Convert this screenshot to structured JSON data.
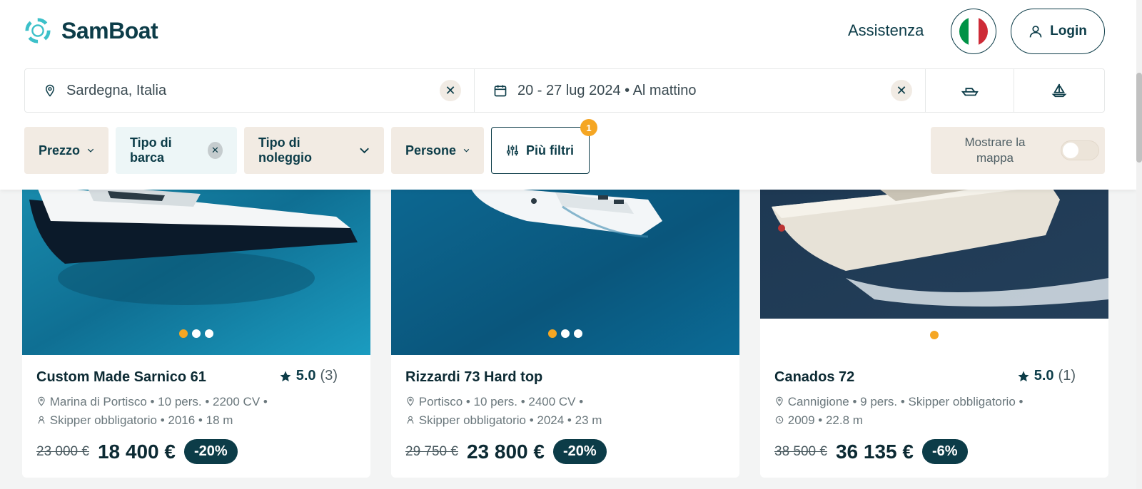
{
  "header": {
    "brand": "SamBoat",
    "assistenza": "Assistenza",
    "login": "Login",
    "flag": "italy-flag"
  },
  "search": {
    "location": "Sardegna, Italia",
    "dates": "20 - 27 lug 2024 • Al mattino"
  },
  "filters": {
    "prezzo": "Prezzo",
    "tipo_barca": "Tipo di barca",
    "tipo_noleggio": "Tipo di noleggio",
    "persone": "Persone",
    "piu_filtri": "Più filtri",
    "piu_filtri_badge": "1",
    "map_label": "Mostrare la mappa"
  },
  "cards": [
    {
      "title": "Custom Made Sarnico 61",
      "rating": "5.0",
      "reviews": "(3)",
      "meta1": "Marina di Portisco • 10 pers. • 2200 CV •",
      "meta2": "Skipper obbligatorio • 2016 • 18 m",
      "old_price": "23 000 €",
      "price": "18 400 €",
      "discount": "-20%"
    },
    {
      "title": "Rizzardi 73 Hard top",
      "rating": "",
      "reviews": "",
      "meta1": "Portisco • 10 pers. • 2400 CV •",
      "meta2": "Skipper obbligatorio • 2024 • 23 m",
      "old_price": "29 750 €",
      "price": "23 800 €",
      "discount": "-20%"
    },
    {
      "title": "Canados 72",
      "rating": "5.0",
      "reviews": "(1)",
      "meta1": "Cannigione • 9 pers. • Skipper obbligatorio •",
      "meta2": "2009 • 22.8 m",
      "old_price": "38 500 €",
      "price": "36 135 €",
      "discount": "-6%"
    }
  ],
  "colors": {
    "brand": "#0c3c48",
    "accent": "#f5a623",
    "chip": "#f2ebe3"
  }
}
